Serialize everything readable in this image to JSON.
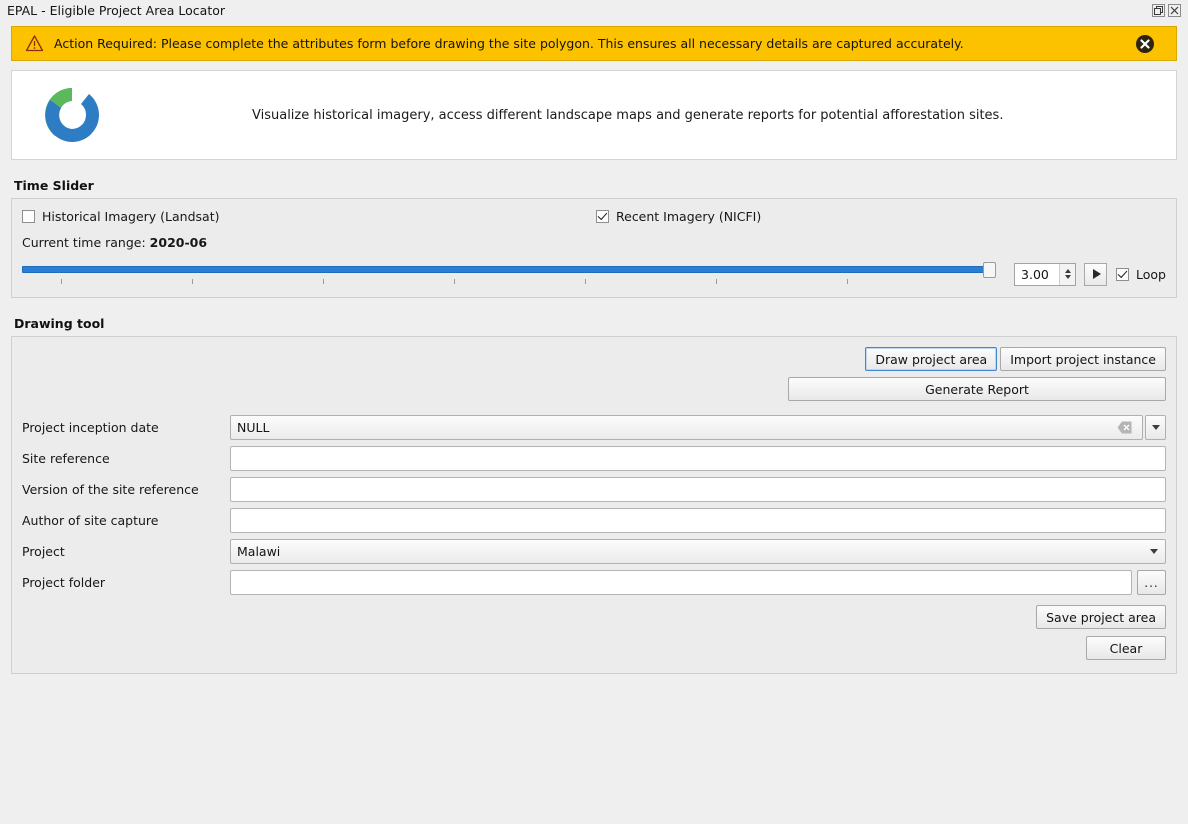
{
  "window": {
    "title": "EPAL - Eligible Project Area Locator",
    "float_icon": "float-window-icon",
    "close_icon": "close-window-icon"
  },
  "banner": {
    "warning_icon": "warning-triangle-icon",
    "message": "Action Required: Please complete the attributes form before drawing the site polygon. This ensures all necessary details are captured accurately.",
    "close_icon": "close-icon",
    "background_color": "#fcc200",
    "text_color": "#141414"
  },
  "hero": {
    "logo_icon": "epal-logo-icon",
    "logo_green": "#5cb85c",
    "logo_blue": "#2e7cc4",
    "description": "Visualize historical imagery, access different landscape maps and generate reports for potential afforestation sites."
  },
  "time_slider": {
    "group_title": "Time Slider",
    "historical": {
      "label": "Historical Imagery (Landsat)",
      "checked": false
    },
    "recent": {
      "label": "Recent Imagery (NICFI)",
      "checked": true
    },
    "current_range_prefix": "Current time range: ",
    "current_range_value": "2020-06",
    "slider": {
      "fill_color": "#2a7fd4",
      "position_percent": 98,
      "tick_count": 7
    },
    "speed_value": "3.00",
    "play_icon": "play-icon",
    "loop": {
      "label": "Loop",
      "checked": true
    }
  },
  "drawing_tool": {
    "group_title": "Drawing tool",
    "draw_button": "Draw project area",
    "import_button": "Import project instance",
    "generate_button": "Generate Report",
    "fields": [
      {
        "label": "Project inception date",
        "value": "NULL",
        "placeholder": "",
        "type": "date",
        "clear_icon": "clear-field-icon",
        "dropdown_icon": "chevron-down-icon"
      },
      {
        "label": "Site reference",
        "value": "",
        "placeholder": "",
        "type": "text"
      },
      {
        "label": "Version of the site reference",
        "value": "",
        "placeholder": "",
        "type": "text"
      },
      {
        "label": "Author of site capture",
        "value": "",
        "placeholder": "",
        "type": "text"
      },
      {
        "label": "Project",
        "value": "Malawi",
        "placeholder": "",
        "type": "combo",
        "dropdown_icon": "chevron-down-icon"
      },
      {
        "label": "Project folder",
        "value": "",
        "placeholder": "",
        "type": "folder",
        "browse_label": "...",
        "browse_icon": "browse-folder-icon"
      }
    ],
    "save_button": "Save project area",
    "clear_button": "Clear"
  }
}
